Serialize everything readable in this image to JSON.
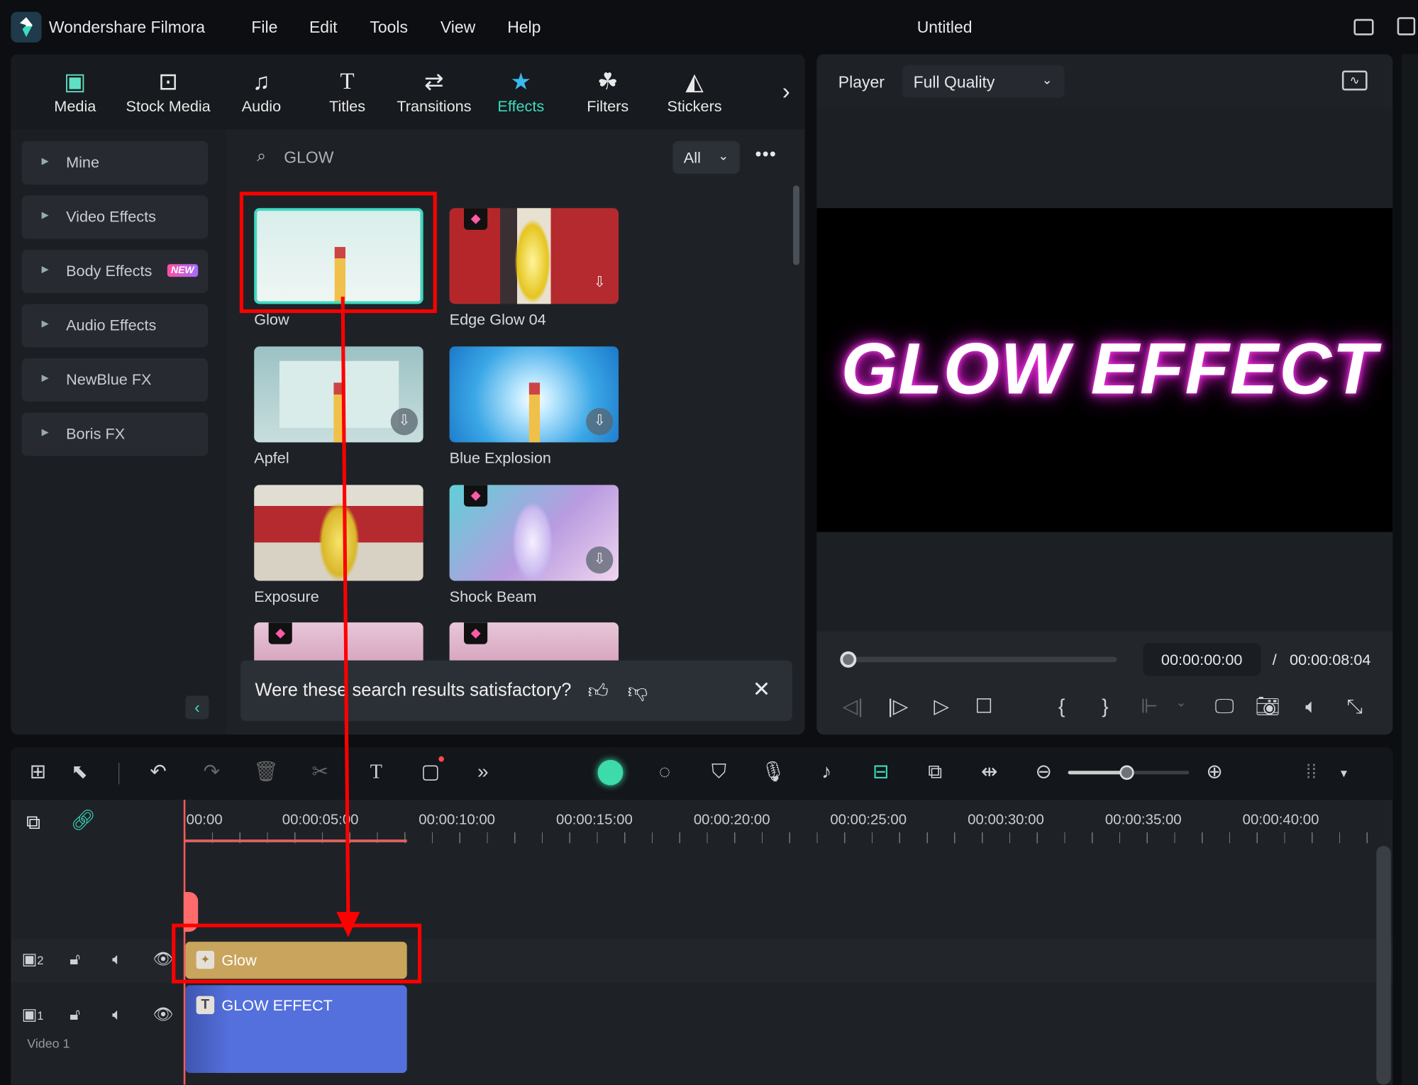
{
  "app": {
    "name": "Wondershare Filmora",
    "title": "Untitled",
    "menu": [
      "File",
      "Edit",
      "Tools",
      "View",
      "Help"
    ]
  },
  "toolbar": {
    "tabs": [
      {
        "label": "Media",
        "icon": "media-icon"
      },
      {
        "label": "Stock Media",
        "icon": "stock-media-icon"
      },
      {
        "label": "Audio",
        "icon": "music-note-icon"
      },
      {
        "label": "Titles",
        "icon": "title-t-icon"
      },
      {
        "label": "Transitions",
        "icon": "transitions-icon"
      },
      {
        "label": "Effects",
        "icon": "effects-star-icon",
        "active": true
      },
      {
        "label": "Filters",
        "icon": "filters-icon"
      },
      {
        "label": "Stickers",
        "icon": "stickers-icon"
      }
    ],
    "accent": "#3ddbc0"
  },
  "sidebar": {
    "items": [
      {
        "label": "Mine"
      },
      {
        "label": "Video Effects"
      },
      {
        "label": "Body Effects",
        "badge": "NEW"
      },
      {
        "label": "Audio Effects"
      },
      {
        "label": "NewBlue FX"
      },
      {
        "label": "Boris FX"
      }
    ]
  },
  "search": {
    "value": "GLOW",
    "filter": "All"
  },
  "effects": [
    {
      "label": "Glow",
      "selected": true
    },
    {
      "label": "Edge Glow 04",
      "premium": true,
      "download": true
    },
    {
      "label": "Apfel",
      "download": true
    },
    {
      "label": "Blue Explosion",
      "download": true
    },
    {
      "label": "Exposure"
    },
    {
      "label": "Shock Beam",
      "premium": true,
      "download": true
    }
  ],
  "feedback": {
    "text": "Were these search results satisfactory?"
  },
  "player": {
    "label": "Player",
    "quality": "Full Quality",
    "preview_text": "GLOW EFFECT",
    "current_time": "00:00:00:00",
    "separator": "/",
    "total_time": "00:00:08:04",
    "progress": 0
  },
  "timeline": {
    "ruler": [
      "00:00",
      "00:00:05:00",
      "00:00:10:00",
      "00:00:15:00",
      "00:00:20:00",
      "00:00:25:00",
      "00:00:30:00",
      "00:00:35:00",
      "00:00:40:00"
    ],
    "zoom_level": 0.48,
    "tracks": [
      {
        "number": "2",
        "clip": "Glow",
        "clip_color": "#c9a45c"
      },
      {
        "number": "1",
        "name": "Video 1",
        "clip": "GLOW EFFECT",
        "clip_color": "#5470dc"
      }
    ]
  },
  "annotation_color": "#ff0000"
}
